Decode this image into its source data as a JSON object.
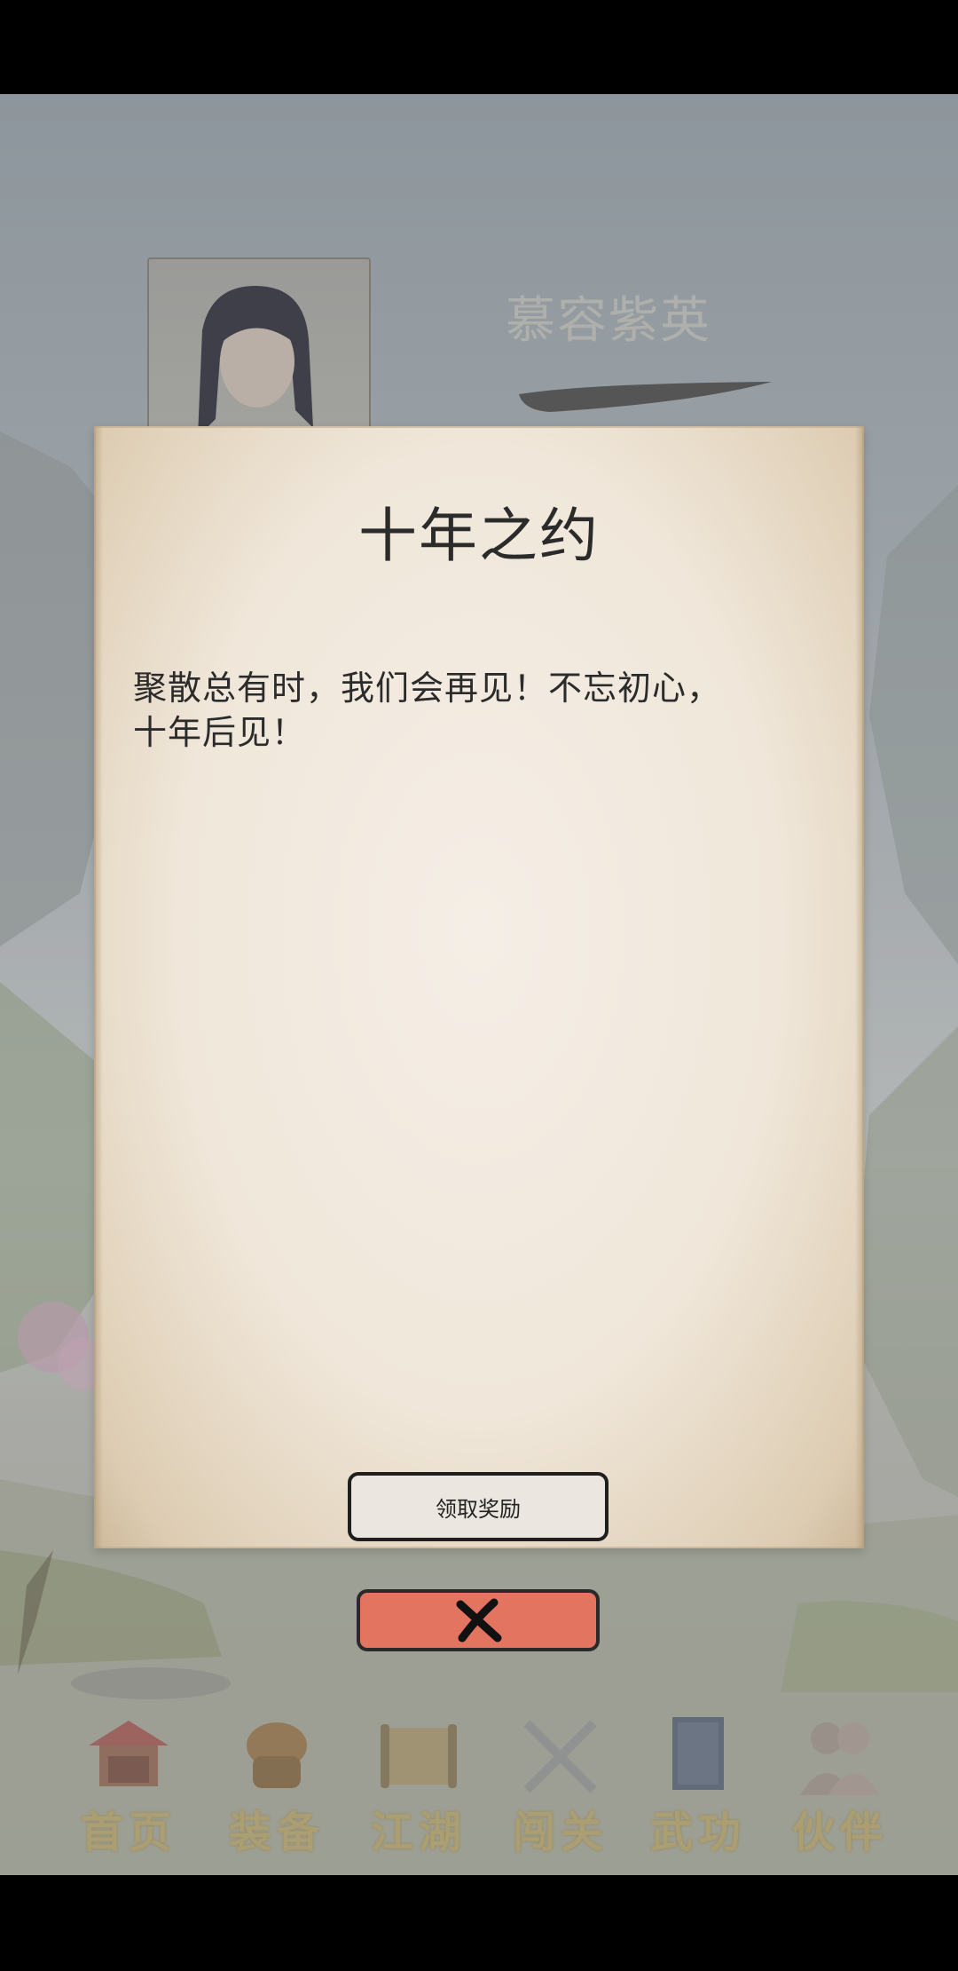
{
  "character": {
    "name": "慕容紫英"
  },
  "dialog": {
    "title": "十年之约",
    "body_line1": "聚散总有时，我们会再见！不忘初心，",
    "body_line2": "十年后见！",
    "claim_button": "领取奖励"
  },
  "close_button_icon": "close-x-icon",
  "bottom_nav": {
    "items": [
      {
        "label": "首页",
        "icon": "pavilion-icon"
      },
      {
        "label": "装备",
        "icon": "armor-icon"
      },
      {
        "label": "江湖",
        "icon": "scroll-icon"
      },
      {
        "label": "闯关",
        "icon": "crossed-swords-icon"
      },
      {
        "label": "武功",
        "icon": "book-icon"
      },
      {
        "label": "伙伴",
        "icon": "partners-icon"
      }
    ]
  },
  "colors": {
    "close_button": "#e37560",
    "paper": "#f0e7da",
    "nav_label": "#b09e64"
  }
}
